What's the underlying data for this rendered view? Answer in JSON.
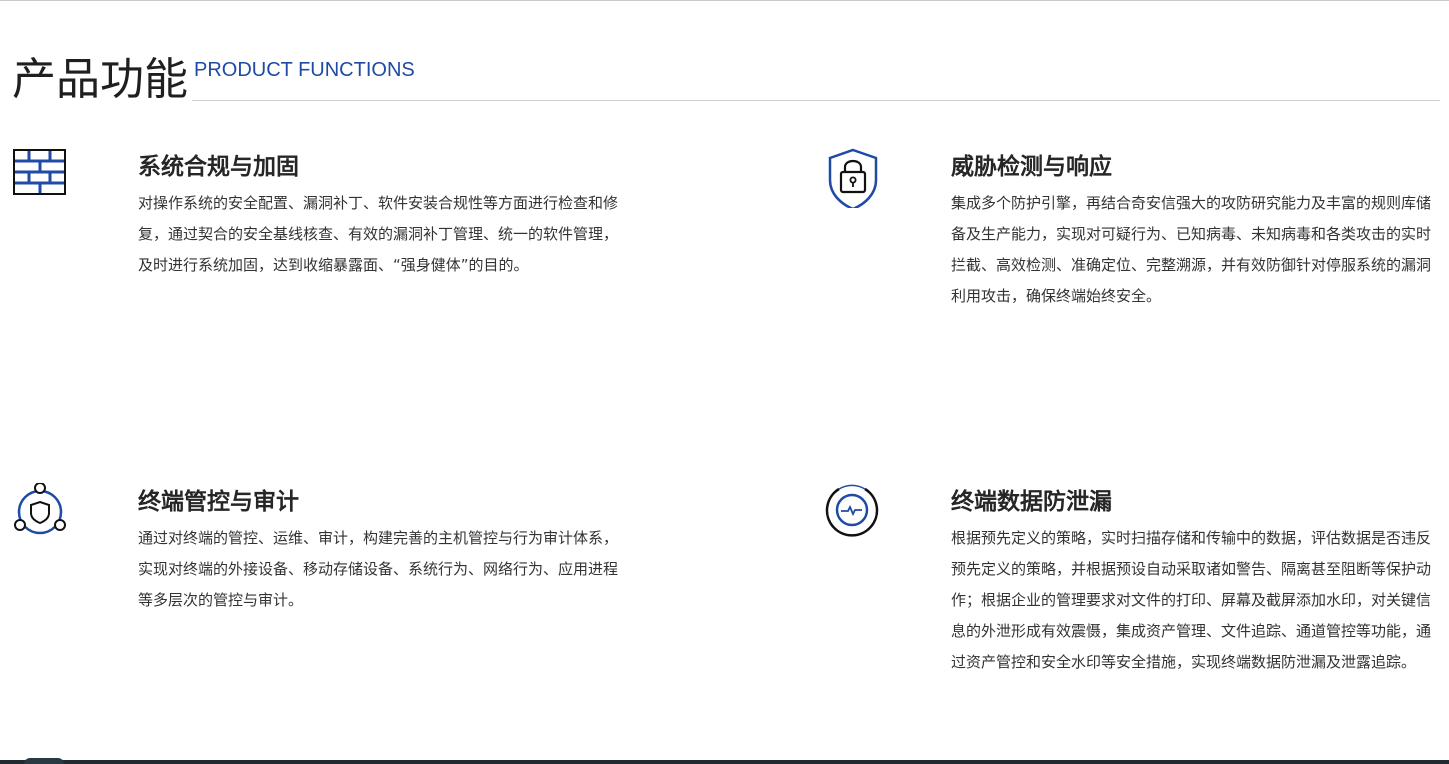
{
  "header": {
    "title": "产品功能",
    "subtitle": "PRODUCT FUNCTIONS",
    "accent_color": "#1f4aa5"
  },
  "features": [
    {
      "icon": "brick-wall-icon",
      "title": "系统合规与加固",
      "description": "对操作系统的安全配置、漏洞补丁、软件安装合规性等方面进行检查和修复，通过契合的安全基线核查、有效的漏洞补丁管理、统一的软件管理，及时进行系统加固，达到收缩暴露面、“强身健体”的目的。"
    },
    {
      "icon": "shield-lock-icon",
      "title": "威胁检测与响应",
      "description": "集成多个防护引擎，再结合奇安信强大的攻防研究能力及丰富的规则库储备及生产能力，实现对可疑行为、已知病毒、未知病毒和各类攻击的实时拦截、高效检测、准确定位、完整溯源，并有效防御针对停服系统的漏洞利用攻击，确保终端始终安全。"
    },
    {
      "icon": "shield-network-icon",
      "title": "终端管控与审计",
      "description": "通过对终端的管控、运维、审计，构建完善的主机管控与行为审计体系，实现对终端的外接设备、移动存储设备、系统行为、网络行为、应用进程等多层次的管控与审计。"
    },
    {
      "icon": "data-monitor-icon",
      "title": "终端数据防泄漏",
      "description": "根据预先定义的策略，实时扫描存储和传输中的数据，评估数据是否违反预先定义的策略，并根据预设自动采取诸如警告、隔离甚至阻断等保护动作；根据企业的管理要求对文件的打印、屏幕及截屏添加水印，对关键信息的外泄形成有效震慑，集成资产管理、文件追踪、通道管控等功能，通过资产管控和安全水印等安全措施，实现终端数据防泄漏及泄露追踪。"
    }
  ]
}
